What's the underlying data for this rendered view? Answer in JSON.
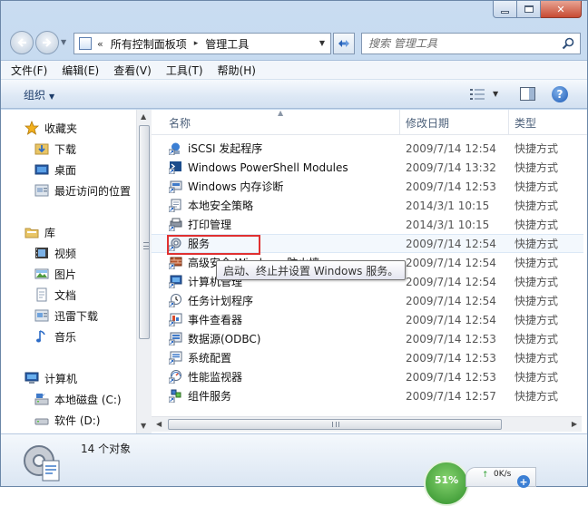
{
  "window": {
    "caption": {
      "minimize": "─",
      "maximize": "□",
      "close": "✕"
    }
  },
  "nav": {
    "address": {
      "chevron": "«",
      "segments": [
        "所有控制面板项",
        "管理工具"
      ],
      "separator": "▸"
    },
    "search": {
      "placeholder": "搜索 管理工具"
    }
  },
  "menu": [
    "文件(F)",
    "编辑(E)",
    "查看(V)",
    "工具(T)",
    "帮助(H)"
  ],
  "toolbar": {
    "organize": "组织",
    "help": "?"
  },
  "navpane": {
    "items": [
      {
        "label": "收藏夹",
        "icon": "favorites-star-icon"
      },
      {
        "label": "下载",
        "icon": "downloads-folder-icon"
      },
      {
        "label": "桌面",
        "icon": "desktop-icon"
      },
      {
        "label": "最近访问的位置",
        "icon": "recent-places-icon"
      },
      {
        "label": "库",
        "icon": "libraries-icon"
      },
      {
        "label": "视频",
        "icon": "video-library-icon"
      },
      {
        "label": "图片",
        "icon": "pictures-library-icon"
      },
      {
        "label": "文档",
        "icon": "documents-library-icon"
      },
      {
        "label": "迅雷下载",
        "icon": "thunder-download-icon"
      },
      {
        "label": "音乐",
        "icon": "music-library-icon"
      },
      {
        "label": "计算机",
        "icon": "computer-icon"
      },
      {
        "label": "本地磁盘 (C:)",
        "icon": "local-disk-icon"
      },
      {
        "label": "软件 (D:)",
        "icon": "drive-icon"
      }
    ]
  },
  "files": {
    "columns": {
      "name": "名称",
      "date": "修改日期",
      "type": "类型"
    },
    "rows": [
      {
        "name": "iSCSI 发起程序",
        "date": "2009/7/14 12:54",
        "type": "快捷方式"
      },
      {
        "name": "Windows PowerShell Modules",
        "date": "2009/7/14 13:32",
        "type": "快捷方式"
      },
      {
        "name": "Windows 内存诊断",
        "date": "2009/7/14 12:53",
        "type": "快捷方式"
      },
      {
        "name": "本地安全策略",
        "date": "2014/3/1 10:15",
        "type": "快捷方式"
      },
      {
        "name": "打印管理",
        "date": "2014/3/1 10:15",
        "type": "快捷方式"
      },
      {
        "name": "服务",
        "date": "2009/7/14 12:54",
        "type": "快捷方式"
      },
      {
        "name": "高级安全 Windows 防火墙",
        "date": "2009/7/14 12:54",
        "type": "快捷方式"
      },
      {
        "name": "计算机管理",
        "date": "2009/7/14 12:54",
        "type": "快捷方式"
      },
      {
        "name": "任务计划程序",
        "date": "2009/7/14 12:54",
        "type": "快捷方式"
      },
      {
        "name": "事件查看器",
        "date": "2009/7/14 12:54",
        "type": "快捷方式"
      },
      {
        "name": "数据源(ODBC)",
        "date": "2009/7/14 12:53",
        "type": "快捷方式"
      },
      {
        "name": "系统配置",
        "date": "2009/7/14 12:53",
        "type": "快捷方式"
      },
      {
        "name": "性能监视器",
        "date": "2009/7/14 12:53",
        "type": "快捷方式"
      },
      {
        "name": "组件服务",
        "date": "2009/7/14 12:57",
        "type": "快捷方式"
      }
    ]
  },
  "tooltip": "启动、终止并设置 Windows 服务。",
  "status": {
    "count": "14 个对象",
    "meter": "51%",
    "net_speed": "0K/s",
    "net_up": "↑",
    "net_plus": "+"
  }
}
